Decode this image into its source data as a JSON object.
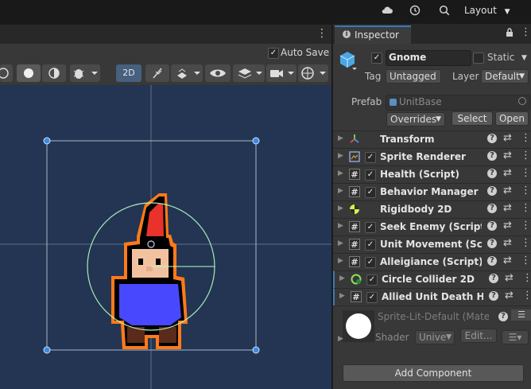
{
  "toolbar": {
    "layout_label": "Layout",
    "icons": [
      "cloud-icon",
      "history-icon",
      "search-icon"
    ]
  },
  "scene": {
    "auto_save_label": "Auto Save",
    "auto_save_checked": true,
    "mode_2d_label": "2D",
    "more_icon": "⋮"
  },
  "inspector": {
    "tab_label": "Inspector",
    "object_name": "Gnome",
    "static_label": "Static",
    "tag_label": "Tag",
    "tag_value": "Untagged",
    "layer_label": "Layer",
    "layer_value": "Default",
    "prefab_label": "Prefab",
    "prefab_value": "UnitBase",
    "overrides_label": "Overrides",
    "select_label": "Select",
    "open_label": "Open",
    "components": [
      {
        "name": "Transform",
        "has_checkbox": false,
        "icon": "transform-icon"
      },
      {
        "name": "Sprite Renderer",
        "has_checkbox": true,
        "icon": "sprite-renderer-icon"
      },
      {
        "name": "Health (Script)",
        "has_checkbox": true,
        "icon": "script-icon"
      },
      {
        "name": "Behavior Manager (Script)",
        "has_checkbox": true,
        "icon": "script-icon"
      },
      {
        "name": "Rigidbody 2D",
        "has_checkbox": false,
        "icon": "rigidbody-icon"
      },
      {
        "name": "Seek Enemy (Script)",
        "has_checkbox": true,
        "icon": "script-icon"
      },
      {
        "name": "Unit Movement (Script)",
        "has_checkbox": true,
        "icon": "script-icon"
      },
      {
        "name": "Alleigiance (Script)",
        "has_checkbox": true,
        "icon": "script-icon"
      },
      {
        "name": "Circle Collider 2D",
        "has_checkbox": true,
        "icon": "circle-collider-icon"
      },
      {
        "name": "Allied Unit Death Handler",
        "has_checkbox": true,
        "icon": "script-icon"
      }
    ],
    "material": {
      "name": "Sprite-Lit-Default (Material)",
      "shader_label": "Shader",
      "shader_value": "Unive",
      "edit_label": "Edit..."
    },
    "add_component_label": "Add Component"
  }
}
